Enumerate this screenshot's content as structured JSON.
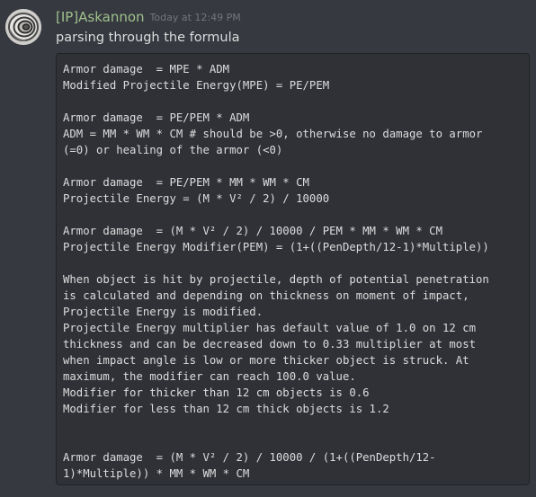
{
  "message": {
    "author": "[IP]Askannon",
    "timestamp": "Today at 12:49 PM",
    "text": "parsing through the formula",
    "avatar_icon": "spiral-shell-avatar-icon",
    "colors": {
      "username": "#9fc08c",
      "background": "#36393f",
      "codeblock_background": "#2f3136"
    },
    "code_lines": [
      "Armor damage  = MPE * ADM",
      "Modified Projectile Energy(MPE) = PE/PEM",
      "",
      "Armor damage  = PE/PEM * ADM",
      "ADM = MM * WM * CM # should be >0, otherwise no damage to armor",
      "(=0) or healing of the armor (<0)",
      "",
      "Armor damage  = PE/PEM * MM * WM * CM",
      "Projectile Energy = (M * V² / 2) / 10000",
      "",
      "Armor damage  = (M * V² / 2) / 10000 / PEM * MM * WM * CM",
      "Projectile Energy Modifier(PEM) = (1+((PenDepth/12-1)*Multiple))",
      "",
      "When object is hit by projectile, depth of potential penetration",
      "is calculated and depending on thickness on moment of impact,",
      "Projectile Energy is modified.",
      "Projectile Energy multiplier has default value of 1.0 on 12 cm",
      "thickness and can be decreased down to 0.33 multiplier at most",
      "when impact angle is low or more thicker object is struck. At",
      "maximum, the modifier can reach 100.0 value.",
      "Modifier for thicker than 12 cm objects is 0.6",
      "Modifier for less than 12 cm thick objects is 1.2",
      "",
      "",
      "Armor damage  = (M * V² / 2) / 10000 / (1+((PenDepth/12-",
      "1)*Multiple)) * MM * WM * CM"
    ]
  }
}
